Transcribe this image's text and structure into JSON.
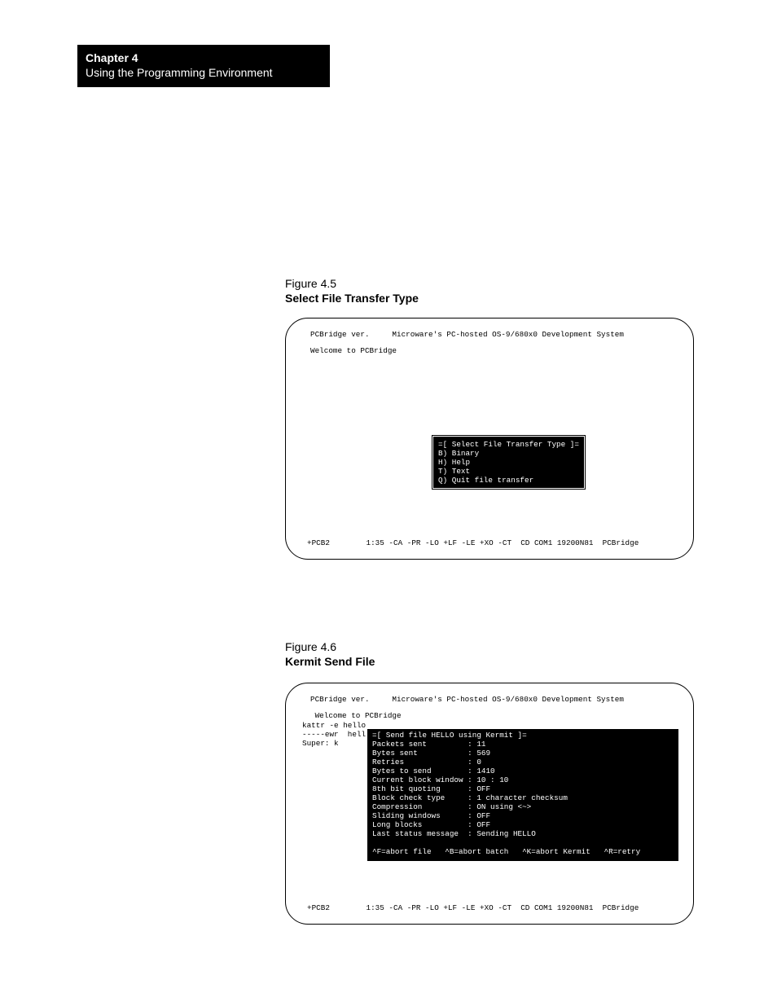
{
  "chapter": {
    "title": "Chapter  4",
    "subtitle": "Using the Programming Environment"
  },
  "fig45": {
    "num": "Figure 4.5",
    "caption": "Select File Transfer Type",
    "header": "PCBridge ver.     Microware's PC-hosted OS-9/680x0 Development System",
    "welcome": "Welcome to PCBridge",
    "menu_title": "=[ Select File Transfer Type ]=",
    "menu_b": "B) Binary",
    "menu_h": "H) Help",
    "menu_t": "T) Text",
    "menu_q": "Q) Quit file transfer",
    "status": "+PCB2        1:35 -CA -PR -LO +LF -LE +XO -CT  CD COM1 19200N81  PCBridge"
  },
  "fig46": {
    "num": "Figure 4.6",
    "caption": "Kermit Send File",
    "header": "PCBridge ver.     Microware's PC-hosted OS-9/680x0 Development System",
    "welcome": " Welcome to PCBridge",
    "kattr": "kattr -e hello",
    "ewr": "-----ewr  hell",
    "super": "Super: k",
    "panel_title": "=[ Send file HELLO using Kermit ]=",
    "row1": "Packets sent         : 11",
    "row2": "Bytes sent           : 569",
    "row3": "Retries              : 0",
    "row4": "Bytes to send        : 1410",
    "row5": "Current block window : 10 : 10",
    "row6": "8th bit quoting      : OFF",
    "row7": "Block check type     : 1 character checksum",
    "row8": "Compression          : ON using <~>",
    "row9": "Sliding windows      : OFF",
    "row10": "Long blocks          : OFF",
    "row11": "Last status message  : Sending HELLO",
    "hints": "^F=abort file   ^B=abort batch   ^K=abort Kermit   ^R=retry",
    "status": "+PCB2        1:35 -CA -PR -LO +LF -LE +XO -CT  CD COM1 19200N81  PCBridge"
  }
}
